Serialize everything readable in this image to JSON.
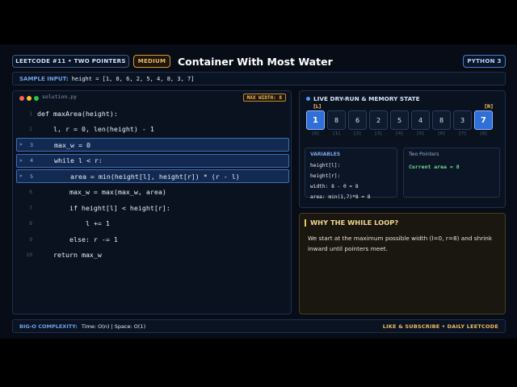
{
  "header": {
    "tag": "LEETCODE #11 • TWO POINTERS",
    "difficulty": "MEDIUM",
    "title": "Container With Most Water",
    "language": "PYTHON 3"
  },
  "sample": {
    "label": "SAMPLE INPUT:",
    "value": "height = [1, 8, 6, 2, 5, 4, 8, 3, 7]"
  },
  "code": {
    "filename": "solution.py",
    "max_badge": "MAX WIDTH: 8",
    "lines": [
      {
        "num": "1",
        "text": "def maxArea(height):",
        "highlight": false,
        "arrow": ""
      },
      {
        "num": "2",
        "text": "    l, r = 0, len(height) - 1",
        "highlight": false,
        "arrow": ""
      },
      {
        "num": "3",
        "text": "    max_w = 0",
        "highlight": true,
        "arrow": ">"
      },
      {
        "num": "4",
        "text": "    while l < r:",
        "highlight": true,
        "arrow": ">"
      },
      {
        "num": "5",
        "text": "        area = min(height[l], height[r]) * (r - l)",
        "highlight": true,
        "arrow": ">"
      },
      {
        "num": "6",
        "text": "        max_w = max(max_w, area)",
        "highlight": false,
        "arrow": ""
      },
      {
        "num": "7",
        "text": "        if height[l] < height[r]:",
        "highlight": false,
        "arrow": ""
      },
      {
        "num": "8",
        "text": "            l += 1",
        "highlight": false,
        "arrow": ""
      },
      {
        "num": "9",
        "text": "        else: r -= 1",
        "highlight": false,
        "arrow": ""
      },
      {
        "num": "10",
        "text": "    return max_w",
        "highlight": false,
        "arrow": ""
      }
    ]
  },
  "memory": {
    "title": "LIVE DRY-RUN & MEMORY STATE",
    "left_ptr": "[L]",
    "right_ptr": "[R]",
    "cells": [
      {
        "value": "1",
        "index": "[0]",
        "active": true
      },
      {
        "value": "8",
        "index": "[1]",
        "active": false
      },
      {
        "value": "6",
        "index": "[2]",
        "active": false
      },
      {
        "value": "2",
        "index": "[3]",
        "active": false
      },
      {
        "value": "5",
        "index": "[4]",
        "active": false
      },
      {
        "value": "4",
        "index": "[5]",
        "active": false
      },
      {
        "value": "8",
        "index": "[6]",
        "active": false
      },
      {
        "value": "3",
        "index": "[7]",
        "active": false
      },
      {
        "value": "7",
        "index": "[8]",
        "active": true
      }
    ],
    "variables_title": "VARIABLES",
    "variables": [
      "height[l]:",
      "height[r]:",
      "width:  8 - 0 = 8",
      "area:   min(1,7)*8 = 8"
    ],
    "two_pointers_title": "Two Pointers",
    "current_area": "Current area = 8"
  },
  "why": {
    "title": "WHY THE WHILE LOOP?",
    "body": "We start at the maximum possible width (l=0, r=8) and shrink inward until pointers meet."
  },
  "footer": {
    "label": "BIG-O COMPLEXITY:",
    "complexity": "Time: O(n)  |  Space: O(1)",
    "cta": "LIKE & SUBSCRIBE  •  DAILY LEETCODE"
  },
  "colors": {
    "accent": "#2f6fd8",
    "warning": "#f0b860",
    "success": "#6fe08a"
  }
}
